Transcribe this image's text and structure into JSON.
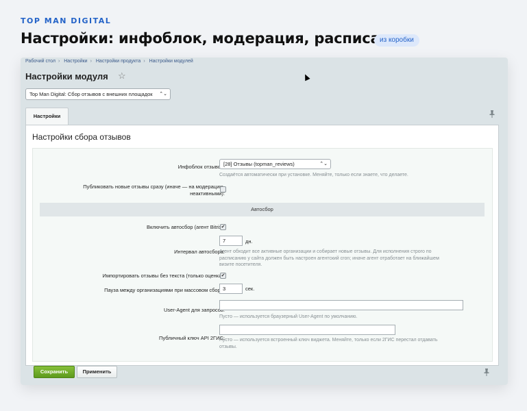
{
  "header": {
    "brand": "TOP MAN DIGITAL",
    "headline": "Настройки: инфоблок, модерация, расписание",
    "badge": "из коробки"
  },
  "breadcrumbs": [
    "Рабочий стол",
    "Настройки",
    "Настройки продукта",
    "Настройки модулей"
  ],
  "breadcrumb_separator": "›",
  "page": {
    "title": "Настройки модуля",
    "module_select_value": "Top Man Digital: Сбор отзывов с внешних площадок"
  },
  "tabs": [
    {
      "label": "Настройки"
    }
  ],
  "section": {
    "title": "Настройки сбора отзывов"
  },
  "form": {
    "iblock": {
      "label": "Инфоблок отзывов:",
      "value": "[28] Отзывы (topman_reviews)",
      "help": "Создаётся автоматически при установке. Меняйте, только если знаете, что делаете."
    },
    "publish_now": {
      "label_line1": "Публиковать новые отзывы сразу (иначе — на модерацию,",
      "label_line2": "неактивными):",
      "checked": false
    },
    "group_header": "Автосбор",
    "autocollect_enable": {
      "label": "Включить автосбор (агент Bitrix):",
      "checked": true
    },
    "interval": {
      "label": "Интервал автосбора:",
      "value": "7",
      "unit": "дн.",
      "help_line1": "Агент обходит все активные организации и собирает новые отзывы. Для исполнения строго по",
      "help_line2": "расписанию у сайта должен быть настроен агентский cron; иначе агент отработает на ближайшем",
      "help_line3": "визите посетителя."
    },
    "import_no_text": {
      "label": "Импортировать отзывы без текста (только оценка):",
      "checked": true
    },
    "pause": {
      "label": "Пауза между организациями при массовом сборе:",
      "value": "3",
      "unit": "сек."
    },
    "user_agent": {
      "label": "User-Agent для запросов:",
      "value": "",
      "help": "Пусто — используется браузерный User-Agent по умолчанию."
    },
    "api_key": {
      "label": "Публичный ключ API 2ГИС:",
      "value": "",
      "help_line1": "Пусто — используется встроенный ключ виджета. Меняйте, только если 2ГИС перестал отдавать",
      "help_line2": "отзывы."
    }
  },
  "buttons": {
    "save": "Сохранить",
    "apply": "Применить"
  },
  "icons": {
    "star": "☆",
    "pin": "📌",
    "check": "✔",
    "chevron": "⌃⌄"
  }
}
